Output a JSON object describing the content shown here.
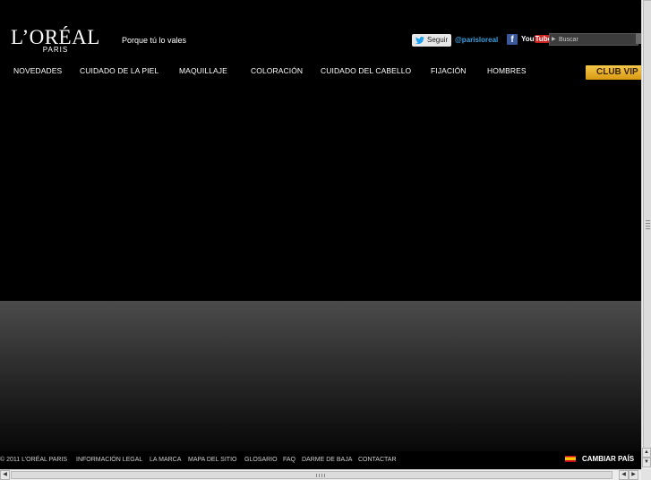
{
  "header": {
    "logo_main": "L’ORÉAL",
    "logo_sub": "PARIS",
    "tagline": "Porque tú lo vales",
    "follow_label": "Seguir",
    "twitter_handle": "@parisloreal",
    "facebook_glyph": "f",
    "youtube_you": "You",
    "youtube_tube": "Tube",
    "search_placeholder": "Buscar"
  },
  "nav": {
    "items": [
      {
        "label": "NOVEDADES"
      },
      {
        "label": "CUIDADO DE LA PIEL"
      },
      {
        "label": "MAQUILLAJE"
      },
      {
        "label": "COLORACIÓN"
      },
      {
        "label": "CUIDADO DEL CABELLO"
      },
      {
        "label": "FIJACIÓN"
      },
      {
        "label": "HOMBRES"
      }
    ],
    "club_vip": "CLUB VIP"
  },
  "footer": {
    "links": [
      {
        "label": "© 2011 L’ORÉAL PARIS"
      },
      {
        "label": "INFORMACIÓN LEGAL"
      },
      {
        "label": "LA MARCA"
      },
      {
        "label": "MAPA DEL SITIO"
      },
      {
        "label": "GLOSARIO"
      },
      {
        "label": "FAQ"
      },
      {
        "label": "DARME DE BAJA"
      },
      {
        "label": "CONTACTAR"
      }
    ],
    "change_country": "CAMBIAR PAÍS"
  },
  "icons": {
    "twitter": "twitter-bird-icon",
    "facebook": "facebook-icon",
    "youtube": "youtube-icon",
    "search": "search-icon",
    "flag": "spain-flag-icon"
  },
  "colors": {
    "background": "#000000",
    "twitter_handle": "#3aa0e0",
    "club_vip": "#e8b22c",
    "facebook": "#3b5998",
    "youtube": "#cc1f1f"
  }
}
